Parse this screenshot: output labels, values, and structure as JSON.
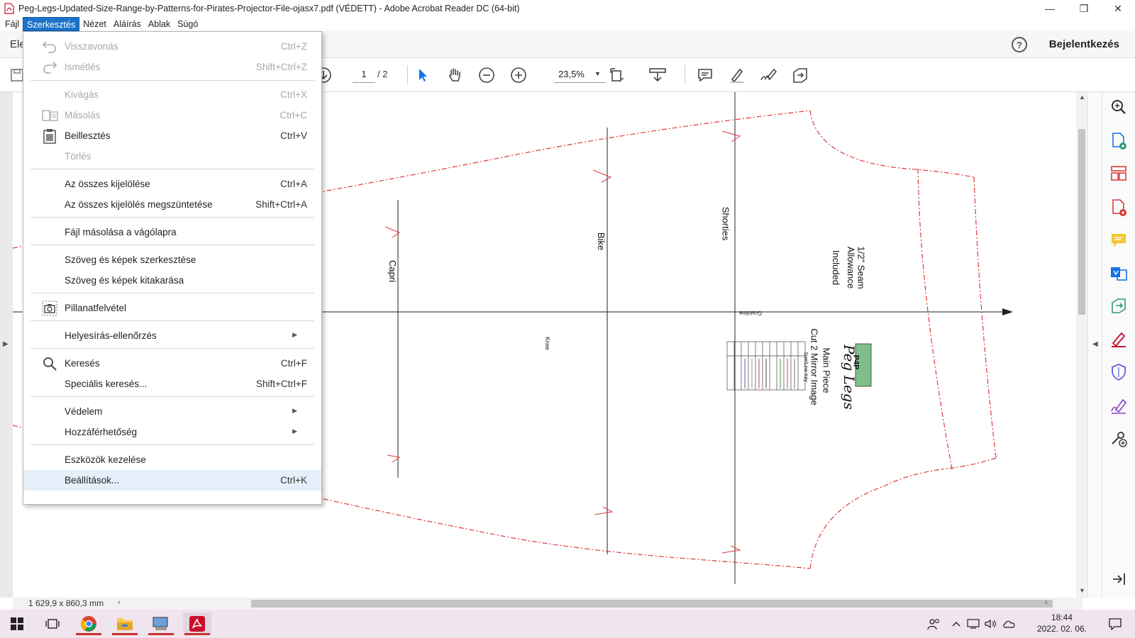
{
  "window": {
    "title": "Peg-Legs-Updated-Size-Range-by-Patterns-for-Pirates-Projector-File-ojasx7.pdf (VÉDETT) - Adobe Acrobat Reader DC (64-bit)",
    "minimize": "—",
    "maximize": "❐",
    "close": "✕"
  },
  "menubar": {
    "items": [
      {
        "label": "Fájl"
      },
      {
        "label": "Szerkesztés"
      },
      {
        "label": "Nézet"
      },
      {
        "label": "Aláírás"
      },
      {
        "label": "Ablak"
      },
      {
        "label": "Súgó"
      }
    ],
    "active": "Szerkesztés"
  },
  "toolheader": {
    "tab_fragment": "Ele",
    "help": "?",
    "signin": "Bejelentkezés"
  },
  "toolbar": {
    "page_current": "1",
    "page_total": "/ 2",
    "zoom": "23,5%"
  },
  "edit_menu": {
    "items": [
      {
        "label": "Visszavonás",
        "shortcut": "Ctrl+Z",
        "disabled": true,
        "icon": "undo-icon"
      },
      {
        "label": "Ismétlés",
        "shortcut": "Shift+Ctrl+Z",
        "disabled": true,
        "icon": "redo-icon"
      },
      {
        "label": "Kivágás",
        "shortcut": "Ctrl+X",
        "disabled": true
      },
      {
        "label": "Másolás",
        "shortcut": "Ctrl+C",
        "disabled": true,
        "icon": "copy-icon"
      },
      {
        "label": "Beillesztés",
        "shortcut": "Ctrl+V",
        "disabled": false,
        "icon": "paste-icon"
      },
      {
        "label": "Törlés",
        "shortcut": "",
        "disabled": true
      },
      {
        "label": "Az összes kijelölése",
        "shortcut": "Ctrl+A",
        "disabled": false
      },
      {
        "label": "Az összes kijelölés megszüntetése",
        "shortcut": "Shift+Ctrl+A",
        "disabled": false
      },
      {
        "label": "Fájl másolása a vágólapra",
        "shortcut": "",
        "disabled": false
      },
      {
        "label": "Szöveg és képek szerkesztése",
        "shortcut": "",
        "disabled": false
      },
      {
        "label": "Szöveg és képek kitakarása",
        "shortcut": "",
        "disabled": false
      },
      {
        "label": "Pillanatfelvétel",
        "shortcut": "",
        "disabled": false,
        "icon": "camera-icon"
      },
      {
        "label": "Helyesírás-ellenőrzés",
        "shortcut": "",
        "disabled": false,
        "submenu": true
      },
      {
        "label": "Keresés",
        "shortcut": "Ctrl+F",
        "disabled": false,
        "icon": "search-icon"
      },
      {
        "label": "Speciális keresés...",
        "shortcut": "Shift+Ctrl+F",
        "disabled": false
      },
      {
        "label": "Védelem",
        "shortcut": "",
        "disabled": false,
        "submenu": true
      },
      {
        "label": "Hozzáférhetőség",
        "shortcut": "",
        "disabled": false,
        "submenu": true
      },
      {
        "label": "Eszközök kezelése",
        "shortcut": "",
        "disabled": false
      },
      {
        "label": "Beállítások...",
        "shortcut": "Ctrl+K",
        "disabled": false,
        "highlighted": true
      }
    ],
    "submenu_arrow": "▶"
  },
  "document": {
    "labels": {
      "capri": "Capri",
      "bike": "Bike",
      "shorties": "Shorties",
      "knee": "Knee",
      "grainline": "Grainline",
      "seam1": "1/2\" Seam",
      "seam2": "Allowance",
      "seam3": "Included",
      "logo": "P4P",
      "title": "Peg Legs",
      "piece": "Main Piece",
      "cut": "Cut 2 Mirror Image",
      "sizekey": "Size/Line Key"
    },
    "line_color": "#e0393c"
  },
  "status": {
    "dimensions": "1 629,9 x 860,3 mm"
  },
  "taskbar": {
    "time": "18:44",
    "date": "2022. 02. 06."
  }
}
